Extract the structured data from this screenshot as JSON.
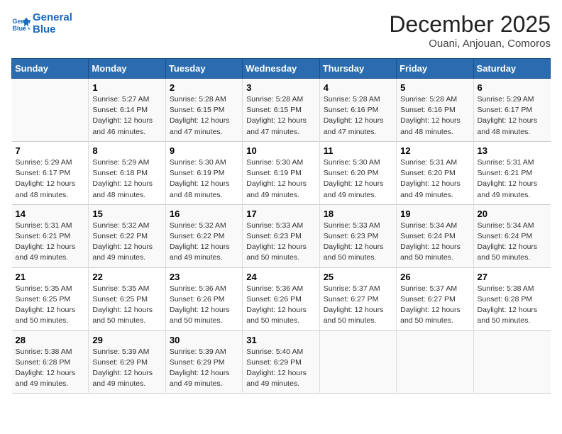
{
  "logo": {
    "line1": "General",
    "line2": "Blue"
  },
  "title": "December 2025",
  "subtitle": "Ouani, Anjouan, Comoros",
  "days_of_week": [
    "Sunday",
    "Monday",
    "Tuesday",
    "Wednesday",
    "Thursday",
    "Friday",
    "Saturday"
  ],
  "weeks": [
    [
      {
        "day": "",
        "info": ""
      },
      {
        "day": "1",
        "info": "Sunrise: 5:27 AM\nSunset: 6:14 PM\nDaylight: 12 hours\nand 46 minutes."
      },
      {
        "day": "2",
        "info": "Sunrise: 5:28 AM\nSunset: 6:15 PM\nDaylight: 12 hours\nand 47 minutes."
      },
      {
        "day": "3",
        "info": "Sunrise: 5:28 AM\nSunset: 6:15 PM\nDaylight: 12 hours\nand 47 minutes."
      },
      {
        "day": "4",
        "info": "Sunrise: 5:28 AM\nSunset: 6:16 PM\nDaylight: 12 hours\nand 47 minutes."
      },
      {
        "day": "5",
        "info": "Sunrise: 5:28 AM\nSunset: 6:16 PM\nDaylight: 12 hours\nand 48 minutes."
      },
      {
        "day": "6",
        "info": "Sunrise: 5:29 AM\nSunset: 6:17 PM\nDaylight: 12 hours\nand 48 minutes."
      }
    ],
    [
      {
        "day": "7",
        "info": "Sunrise: 5:29 AM\nSunset: 6:17 PM\nDaylight: 12 hours\nand 48 minutes."
      },
      {
        "day": "8",
        "info": "Sunrise: 5:29 AM\nSunset: 6:18 PM\nDaylight: 12 hours\nand 48 minutes."
      },
      {
        "day": "9",
        "info": "Sunrise: 5:30 AM\nSunset: 6:19 PM\nDaylight: 12 hours\nand 48 minutes."
      },
      {
        "day": "10",
        "info": "Sunrise: 5:30 AM\nSunset: 6:19 PM\nDaylight: 12 hours\nand 49 minutes."
      },
      {
        "day": "11",
        "info": "Sunrise: 5:30 AM\nSunset: 6:20 PM\nDaylight: 12 hours\nand 49 minutes."
      },
      {
        "day": "12",
        "info": "Sunrise: 5:31 AM\nSunset: 6:20 PM\nDaylight: 12 hours\nand 49 minutes."
      },
      {
        "day": "13",
        "info": "Sunrise: 5:31 AM\nSunset: 6:21 PM\nDaylight: 12 hours\nand 49 minutes."
      }
    ],
    [
      {
        "day": "14",
        "info": "Sunrise: 5:31 AM\nSunset: 6:21 PM\nDaylight: 12 hours\nand 49 minutes."
      },
      {
        "day": "15",
        "info": "Sunrise: 5:32 AM\nSunset: 6:22 PM\nDaylight: 12 hours\nand 49 minutes."
      },
      {
        "day": "16",
        "info": "Sunrise: 5:32 AM\nSunset: 6:22 PM\nDaylight: 12 hours\nand 49 minutes."
      },
      {
        "day": "17",
        "info": "Sunrise: 5:33 AM\nSunset: 6:23 PM\nDaylight: 12 hours\nand 50 minutes."
      },
      {
        "day": "18",
        "info": "Sunrise: 5:33 AM\nSunset: 6:23 PM\nDaylight: 12 hours\nand 50 minutes."
      },
      {
        "day": "19",
        "info": "Sunrise: 5:34 AM\nSunset: 6:24 PM\nDaylight: 12 hours\nand 50 minutes."
      },
      {
        "day": "20",
        "info": "Sunrise: 5:34 AM\nSunset: 6:24 PM\nDaylight: 12 hours\nand 50 minutes."
      }
    ],
    [
      {
        "day": "21",
        "info": "Sunrise: 5:35 AM\nSunset: 6:25 PM\nDaylight: 12 hours\nand 50 minutes."
      },
      {
        "day": "22",
        "info": "Sunrise: 5:35 AM\nSunset: 6:25 PM\nDaylight: 12 hours\nand 50 minutes."
      },
      {
        "day": "23",
        "info": "Sunrise: 5:36 AM\nSunset: 6:26 PM\nDaylight: 12 hours\nand 50 minutes."
      },
      {
        "day": "24",
        "info": "Sunrise: 5:36 AM\nSunset: 6:26 PM\nDaylight: 12 hours\nand 50 minutes."
      },
      {
        "day": "25",
        "info": "Sunrise: 5:37 AM\nSunset: 6:27 PM\nDaylight: 12 hours\nand 50 minutes."
      },
      {
        "day": "26",
        "info": "Sunrise: 5:37 AM\nSunset: 6:27 PM\nDaylight: 12 hours\nand 50 minutes."
      },
      {
        "day": "27",
        "info": "Sunrise: 5:38 AM\nSunset: 6:28 PM\nDaylight: 12 hours\nand 50 minutes."
      }
    ],
    [
      {
        "day": "28",
        "info": "Sunrise: 5:38 AM\nSunset: 6:28 PM\nDaylight: 12 hours\nand 49 minutes."
      },
      {
        "day": "29",
        "info": "Sunrise: 5:39 AM\nSunset: 6:29 PM\nDaylight: 12 hours\nand 49 minutes."
      },
      {
        "day": "30",
        "info": "Sunrise: 5:39 AM\nSunset: 6:29 PM\nDaylight: 12 hours\nand 49 minutes."
      },
      {
        "day": "31",
        "info": "Sunrise: 5:40 AM\nSunset: 6:29 PM\nDaylight: 12 hours\nand 49 minutes."
      },
      {
        "day": "",
        "info": ""
      },
      {
        "day": "",
        "info": ""
      },
      {
        "day": "",
        "info": ""
      }
    ]
  ]
}
